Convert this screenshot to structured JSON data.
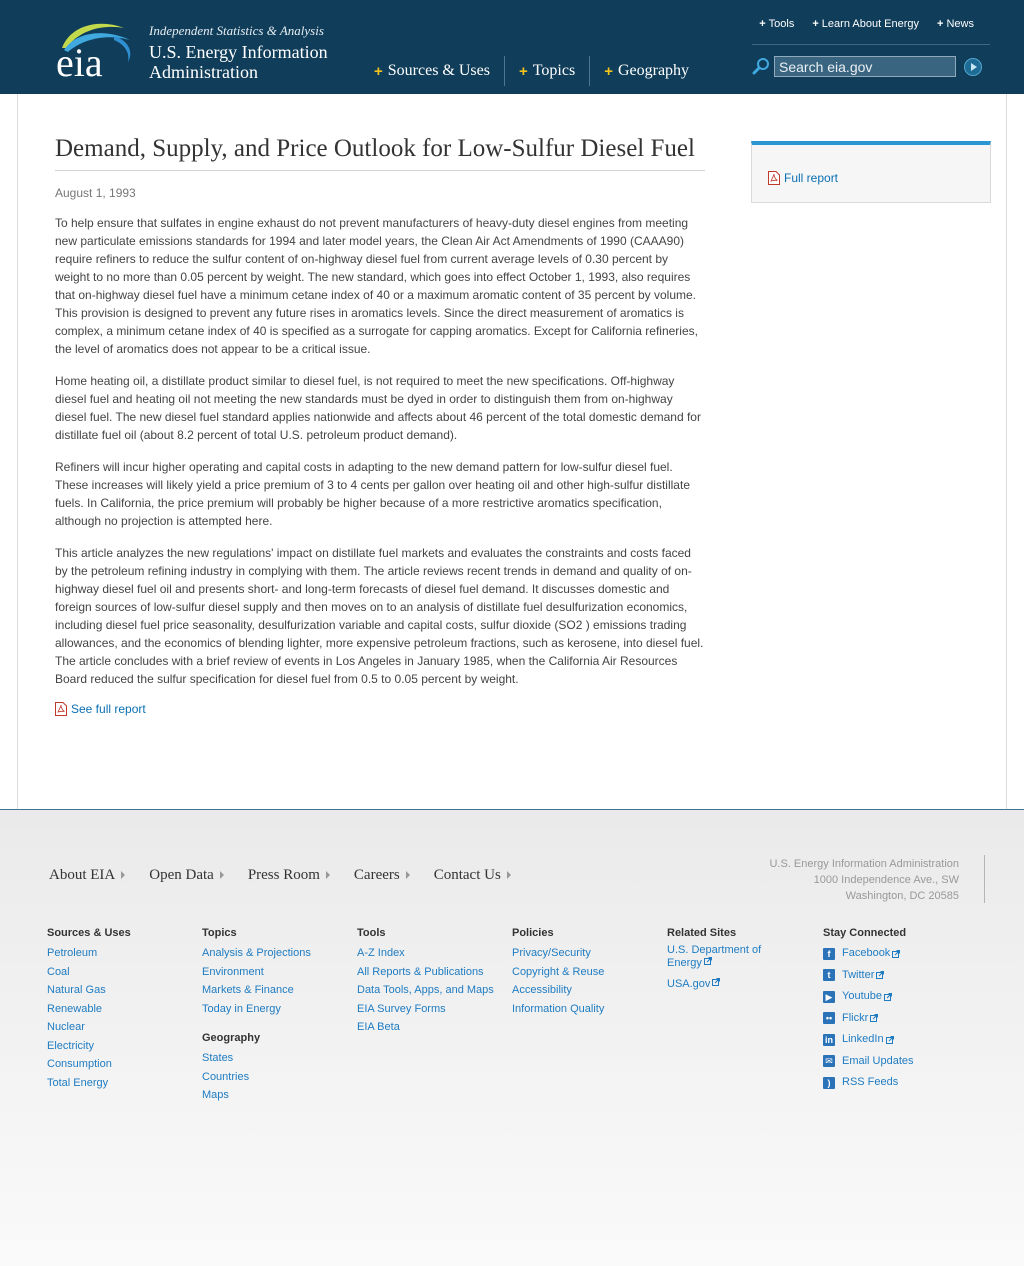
{
  "header": {
    "logo_text": "eia",
    "tagline": "Independent Statistics & Analysis",
    "agency_line1": "U.S. Energy Information",
    "agency_line2": "Administration",
    "main_nav": [
      {
        "label": "Sources & Uses"
      },
      {
        "label": "Topics"
      },
      {
        "label": "Geography"
      }
    ],
    "util_nav": [
      {
        "label": "Tools"
      },
      {
        "label": "Learn About Energy"
      },
      {
        "label": "News"
      }
    ],
    "search": {
      "placeholder": "Search eia.gov"
    }
  },
  "article": {
    "title": "Demand, Supply, and Price Outlook for Low-Sulfur Diesel Fuel",
    "date": "August 1, 1993",
    "paragraphs": [
      "To help ensure that sulfates in engine exhaust do not prevent manufacturers of heavy-duty diesel engines from meeting new particulate emissions standards for 1994 and later model years, the Clean Air Act Amendments of 1990 (CAAA90) require refiners to reduce the sulfur content of on-highway diesel fuel from current average levels of 0.30 percent by weight to no more than 0.05 percent by weight. The new standard, which goes into effect October 1, 1993, also requires that on-highway diesel fuel have a minimum cetane index of 40 or a maximum aromatic content of 35 percent by volume. This provision is designed to prevent any future rises in aromatics levels. Since the direct measurement of aromatics is complex, a minimum cetane index of 40 is specified as a surrogate for capping aromatics. Except for California refineries, the level of aromatics does not appear to be a critical issue.",
      "Home heating oil, a distillate product similar to diesel fuel, is not required to meet the new specifications. Off-highway diesel fuel and heating oil not meeting the new standards must be dyed in order to distinguish them from on-highway diesel fuel. The new diesel fuel standard applies nationwide and affects about 46 percent of the total domestic demand for distillate fuel oil (about 8.2 percent of total U.S. petroleum product demand).",
      "Refiners will incur higher operating and capital costs in adapting to the new demand pattern for low-sulfur diesel fuel. These increases will likely yield a price premium of 3 to 4 cents per gallon over heating oil and other high-sulfur distillate fuels. In California, the price premium will probably be higher because of a more restrictive aromatics specification, although no projection is attempted here.",
      "This article analyzes the new regulations' impact on distillate fuel markets and evaluates the constraints and costs faced by the petroleum refining industry in complying with them. The article reviews recent trends in demand and quality of on-highway diesel fuel oil and presents short- and long-term forecasts of diesel fuel demand. It discusses domestic and foreign sources of low-sulfur diesel supply and then moves on to an analysis of distillate fuel desulfurization economics, including diesel fuel price seasonality, desulfurization variable and capital costs, sulfur dioxide (SO2 ) emissions trading allowances, and the economics of blending lighter, more expensive petroleum fractions, such as kerosene, into diesel fuel. The article concludes with a brief review of events in Los Angeles in January 1985, when the California Air Resources Board reduced the sulfur specification for diesel fuel from 0.5 to 0.05 percent by weight."
    ],
    "full_report_link": "See full report"
  },
  "sidebar": {
    "full_report_link": "Full report"
  },
  "footer": {
    "nav": [
      {
        "label": "About EIA"
      },
      {
        "label": "Open Data"
      },
      {
        "label": "Press Room"
      },
      {
        "label": "Careers"
      },
      {
        "label": "Contact Us"
      }
    ],
    "address": {
      "line1": "U.S. Energy Information Administration",
      "line2": "1000 Independence Ave., SW",
      "line3": "Washington, DC 20585"
    },
    "columns": {
      "sources": {
        "heading": "Sources & Uses",
        "links": [
          "Petroleum",
          "Coal",
          "Natural Gas",
          "Renewable",
          "Nuclear",
          "Electricity",
          "Consumption",
          "Total Energy"
        ]
      },
      "topics": {
        "heading": "Topics",
        "links": [
          "Analysis & Projections",
          "Environment",
          "Markets & Finance",
          "Today in Energy"
        ]
      },
      "geography": {
        "heading": "Geography",
        "links": [
          "States",
          "Countries",
          "Maps"
        ]
      },
      "tools": {
        "heading": "Tools",
        "links": [
          "A-Z Index",
          "All Reports & Publications",
          "Data Tools, Apps, and Maps",
          "EIA Survey Forms",
          "EIA Beta"
        ]
      },
      "policies": {
        "heading": "Policies",
        "links": [
          "Privacy/Security",
          "Copyright & Reuse",
          "Accessibility",
          "Information Quality"
        ]
      },
      "related": {
        "heading": "Related Sites",
        "links": [
          "U.S. Department of Energy",
          "USA.gov"
        ]
      },
      "social": {
        "heading": "Stay Connected",
        "links": [
          {
            "label": "Facebook",
            "icon": "facebook-icon"
          },
          {
            "label": "Twitter",
            "icon": "twitter-icon"
          },
          {
            "label": "Youtube",
            "icon": "youtube-icon"
          },
          {
            "label": "Flickr",
            "icon": "flickr-icon"
          },
          {
            "label": "LinkedIn",
            "icon": "linkedin-icon"
          },
          {
            "label": "Email Updates",
            "icon": "email-icon"
          },
          {
            "label": "RSS Feeds",
            "icon": "rss-icon"
          }
        ]
      }
    }
  },
  "colors": {
    "header_bg": "#0f3d5a",
    "link": "#1f7cc2",
    "accent_plus": "#f2c31b",
    "sidebar_top": "#2b97d2"
  }
}
